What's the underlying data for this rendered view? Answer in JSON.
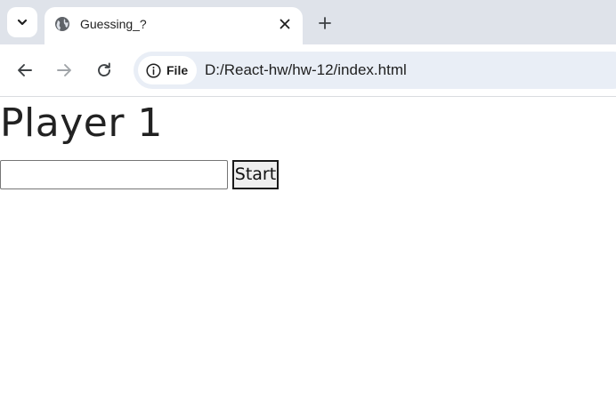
{
  "browser": {
    "tab": {
      "title": "Guessing_?",
      "favicon": "globe-icon"
    },
    "toolbar": {
      "site_chip_label": "File",
      "url": "D:/React-hw/hw-12/index.html"
    },
    "icons": {
      "tab_search": "chevron-down-icon",
      "tab_close": "close-icon",
      "new_tab": "plus-icon",
      "back": "arrow-left-icon",
      "forward": "arrow-right-icon",
      "reload": "reload-icon",
      "site_info": "info-icon"
    }
  },
  "page": {
    "heading": "Player 1",
    "input": {
      "value": "",
      "placeholder": ""
    },
    "start_button_label": "Start"
  },
  "colors": {
    "tabstrip_bg": "#dfe3ea",
    "omnibox_bg": "#e9eef6",
    "text": "#1f1f1f"
  }
}
